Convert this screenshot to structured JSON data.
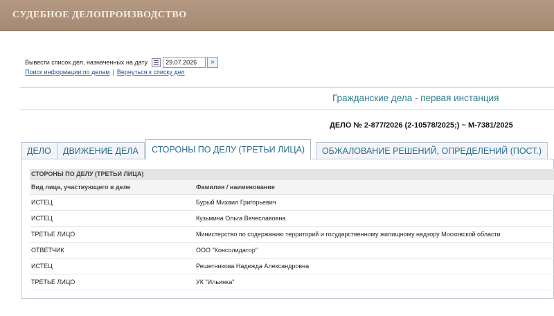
{
  "header": {
    "title": "СУДЕБНОЕ ДЕЛОПРОИЗВОДСТВО"
  },
  "date_filter": {
    "label": "Вывести список дел, назначенных на дату",
    "date_value": "29.07.2026",
    "go_icon": "double-chevron-right-icon",
    "calendar_icon": "calendar-icon"
  },
  "links": {
    "search": "Поиск информации по делам",
    "separator": "|",
    "back": "Вернуться к списку дел"
  },
  "case": {
    "type": "Гражданские дела - первая инстанция",
    "number": "ДЕЛО № 2-877/2026 (2-10578/2025;) ~ М-7381/2025"
  },
  "tabs": [
    {
      "label": "ДЕЛО",
      "active": false
    },
    {
      "label": "ДВИЖЕНИЕ ДЕЛА",
      "active": false
    },
    {
      "label": "СТОРОНЫ ПО ДЕЛУ (ТРЕТЬИ ЛИЦА)",
      "active": true
    },
    {
      "label": "ОБЖАЛОВАНИЕ РЕШЕНИЙ, ОПРЕДЕЛЕНИЙ (ПОСТ.)",
      "active": false
    }
  ],
  "parties_table": {
    "caption": "СТОРОНЫ ПО ДЕЛУ (ТРЕТЬИ ЛИЦА)",
    "columns": [
      "Вид лица, участвующего в деле",
      "Фамилия / наименование"
    ],
    "rows": [
      [
        "ИСТЕЦ",
        "Бурый Михаил Григорьевич"
      ],
      [
        "ИСТЕЦ",
        "Кузьмина Ольга Вячеславовна"
      ],
      [
        "ТРЕТЬЕ ЛИЦО",
        "Министерство по содержанию территорий и государственному жилищному надзору Московской области"
      ],
      [
        "ОТВЕТЧИК",
        "ООО \"Консолидатор\""
      ],
      [
        "ИСТЕЦ",
        "Решетникова Надежда Александровна"
      ],
      [
        "ТРЕТЬЕ ЛИЦО",
        "УК \"Ильинка\""
      ]
    ]
  },
  "colors": {
    "header_bg": "#a98f78",
    "header_text": "#f4ece4",
    "accent_teal": "#2e7a8c",
    "link_blue": "#1a4f9c"
  }
}
